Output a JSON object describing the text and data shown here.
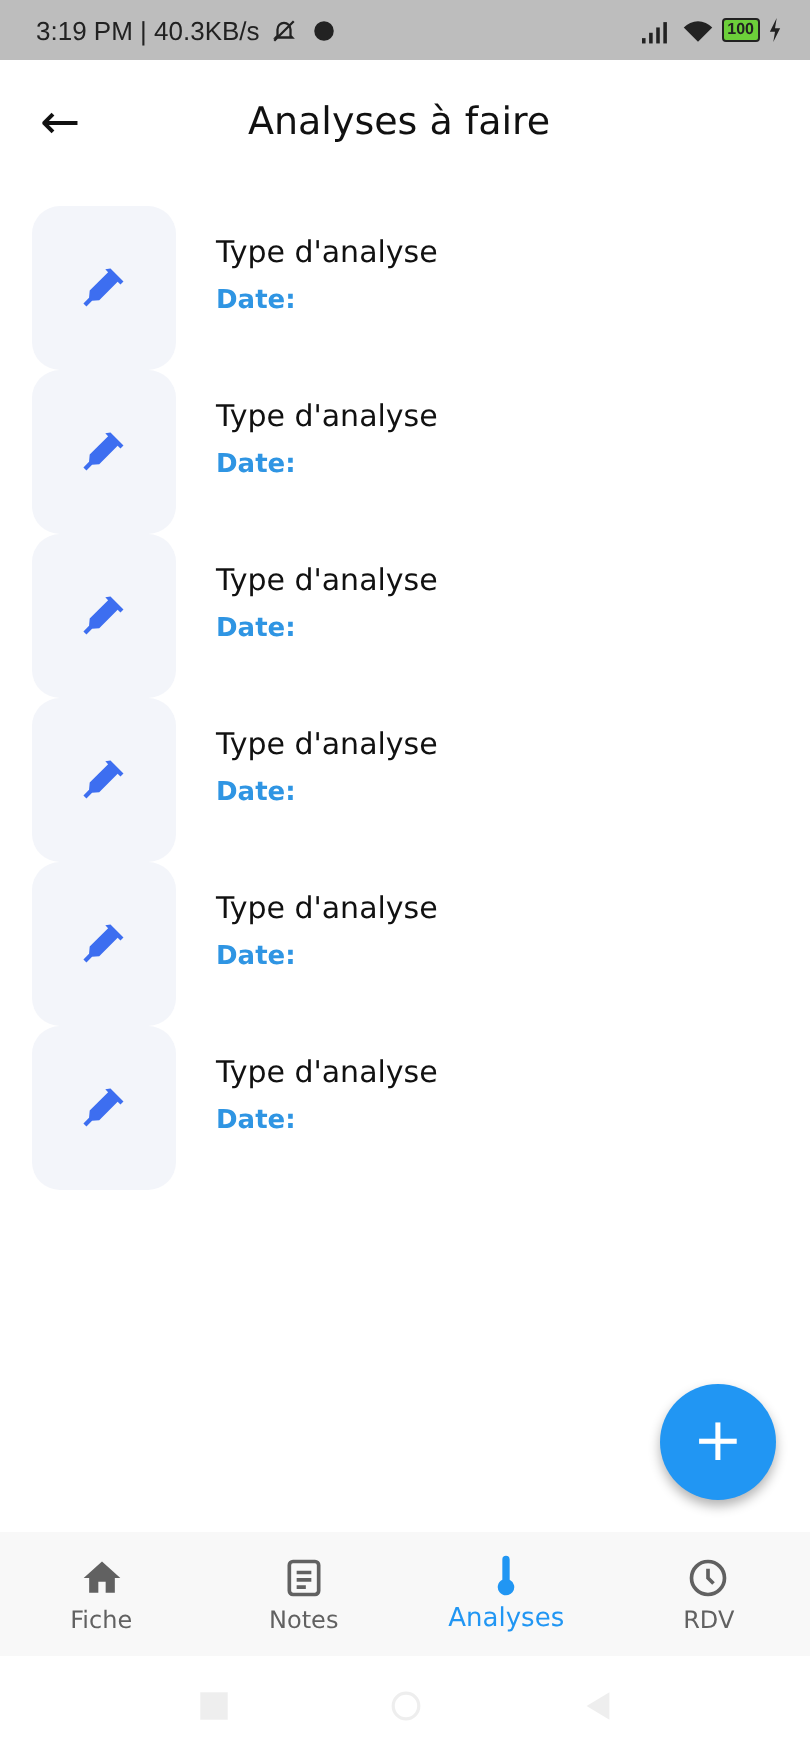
{
  "status_bar": {
    "text": "3:19 PM | 40.3KB/s",
    "battery": "100"
  },
  "app_bar": {
    "back": "←",
    "title": "Analyses à faire"
  },
  "analyses": [
    {
      "type": "Type d'analyse",
      "date": "Date:"
    },
    {
      "type": "Type d'analyse",
      "date": "Date:"
    },
    {
      "type": "Type d'analyse",
      "date": "Date:"
    },
    {
      "type": "Type d'analyse",
      "date": "Date:"
    },
    {
      "type": "Type d'analyse",
      "date": "Date:"
    },
    {
      "type": "Type d'analyse",
      "date": "Date:"
    }
  ],
  "fab": {
    "label": "+"
  },
  "bottom_nav": [
    {
      "kind": "home",
      "label": "Fiche",
      "selected": false
    },
    {
      "kind": "notes",
      "label": "Notes",
      "selected": false
    },
    {
      "kind": "thermometer",
      "label": "Analyses",
      "selected": true
    },
    {
      "kind": "clock",
      "label": "RDV",
      "selected": false
    }
  ]
}
